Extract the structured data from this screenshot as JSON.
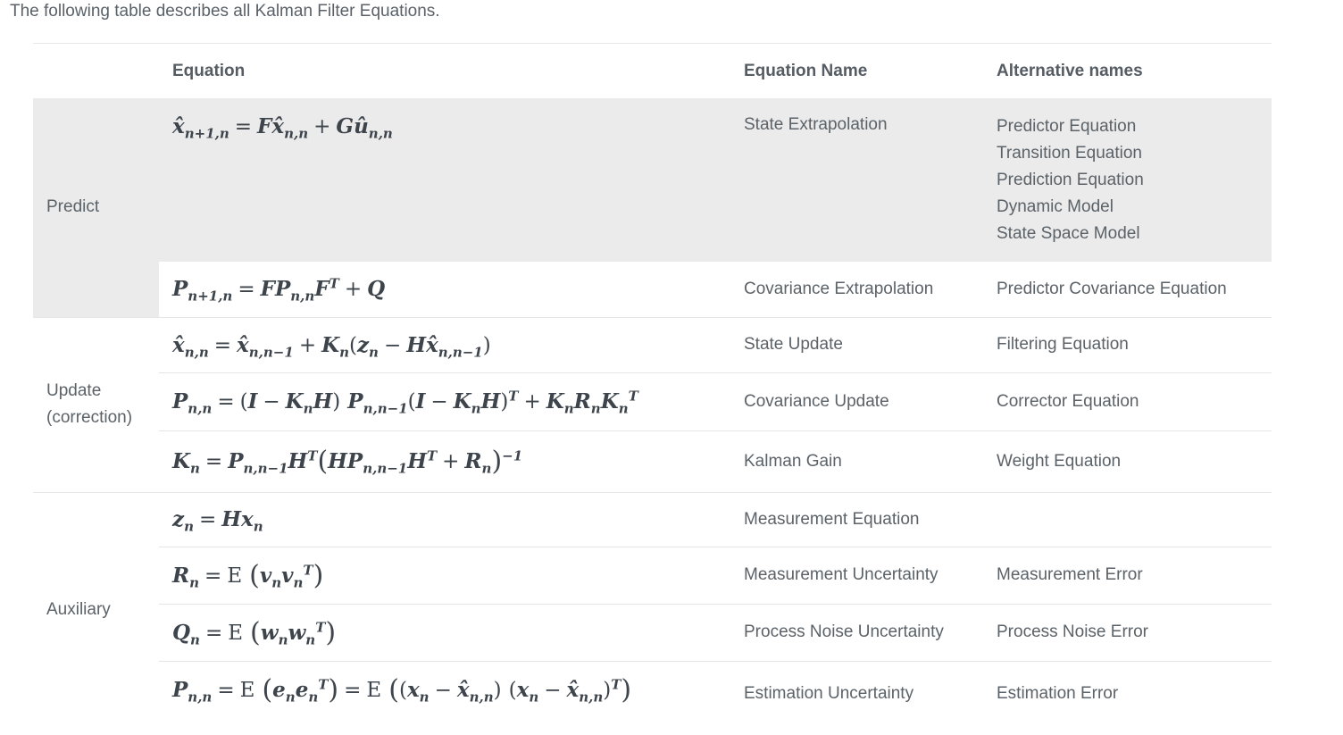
{
  "intro": "The following table describes all Kalman Filter Equations.",
  "headers": {
    "equation": "Equation",
    "name": "Equation Name",
    "alt": "Alternative names"
  },
  "groups": {
    "predict": "Predict",
    "update_1": "Update",
    "update_2": "(correction)",
    "auxiliary": "Auxiliary"
  },
  "rows": [
    {
      "name": "State Extrapolation",
      "alts": [
        "Predictor Equation",
        "Transition Equation",
        "Prediction Equation",
        "Dynamic Model",
        "State Space Model"
      ]
    },
    {
      "name": "Covariance Extrapolation",
      "alt": "Predictor Covariance Equation"
    },
    {
      "name": "State Update",
      "alt": "Filtering Equation"
    },
    {
      "name": "Covariance Update",
      "alt": "Corrector Equation"
    },
    {
      "name": "Kalman Gain",
      "alt": "Weight Equation"
    },
    {
      "name": "Measurement Equation",
      "alt": ""
    },
    {
      "name": "Measurement Uncertainty",
      "alt": "Measurement Error"
    },
    {
      "name": "Process Noise Uncertainty",
      "alt": "Process Noise Error"
    },
    {
      "name": "Estimation Uncertainty",
      "alt": "Estimation Error"
    }
  ]
}
